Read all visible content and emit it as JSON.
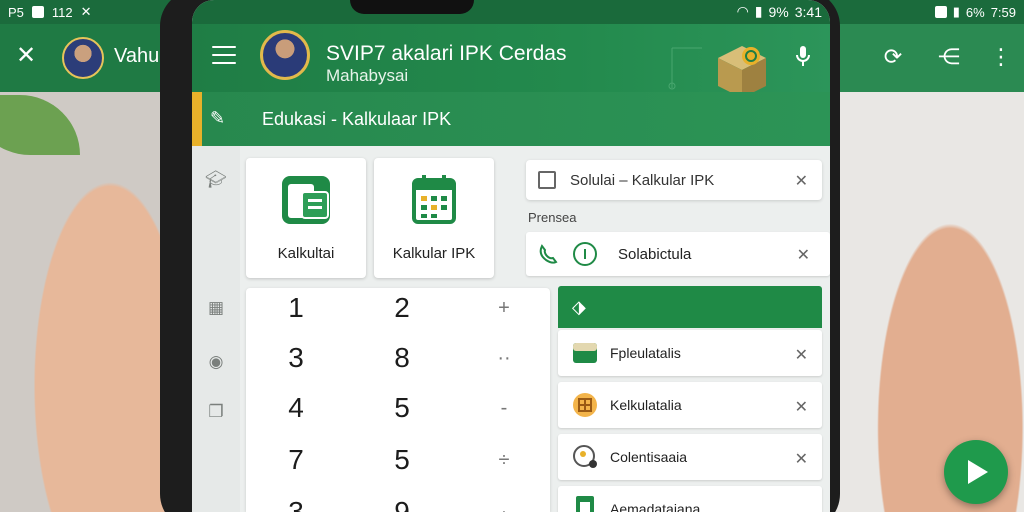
{
  "background": {
    "status_left": [
      "P5",
      "112"
    ],
    "status_right": [
      "6%",
      "7:59"
    ],
    "contact_name": "Vahu"
  },
  "status": {
    "right_text": "9%",
    "time": "3:41"
  },
  "app": {
    "title": "SVIP7 akalari IPK Cerdas",
    "subtitle": "Mahabysai"
  },
  "breadcrumb": {
    "text": "Edukasi - Kalkulaar IPK"
  },
  "tiles": [
    {
      "label": "Kalkultai"
    },
    {
      "label": "Kalkular IPK"
    }
  ],
  "keypad": {
    "rows": [
      [
        "1",
        "2",
        "+"
      ],
      [
        "3",
        "8",
        "··"
      ],
      [
        "4",
        "5",
        "-"
      ],
      [
        "7",
        "5",
        "÷"
      ],
      [
        "3",
        "9",
        "·"
      ]
    ]
  },
  "search": {
    "text": "Solulai – Kalkular IPK"
  },
  "section_label": "Prensea",
  "top_row": {
    "text": "Solabictula"
  },
  "list": [
    {
      "text": "Fpleulatalis"
    },
    {
      "text": "Kelkulatalia"
    },
    {
      "text": "Colentisaaia"
    },
    {
      "text": "Aemadataiana"
    }
  ],
  "colors": {
    "primary_green": "#1f7d45",
    "accent_yellow": "#e8b12a",
    "fab_green": "#1f9a4c"
  }
}
